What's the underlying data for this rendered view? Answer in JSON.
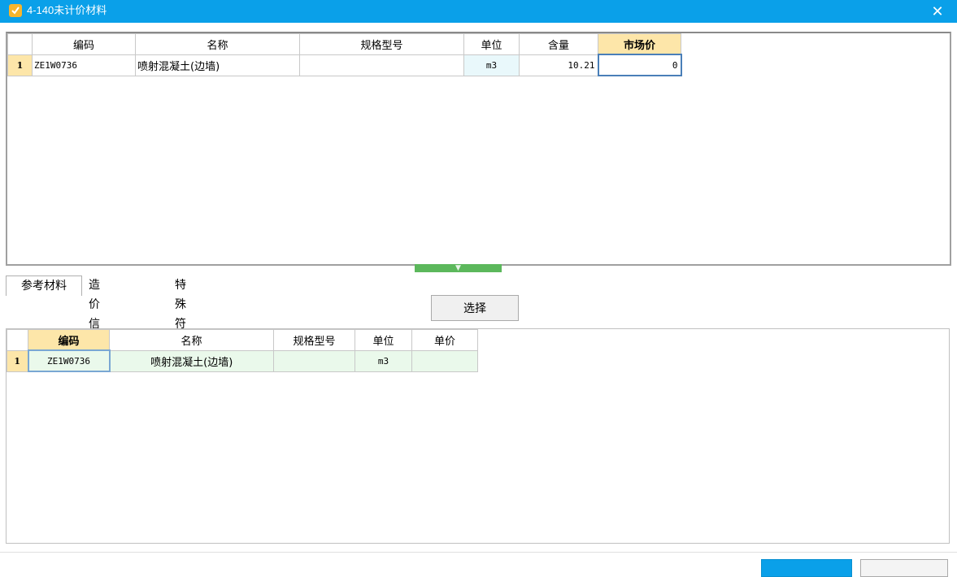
{
  "window": {
    "title": "4-140未计价材料",
    "close_glyph": "✕"
  },
  "top_table": {
    "headers": [
      "编码",
      "名称",
      "规格型号",
      "单位",
      "含量",
      "市场价"
    ],
    "rows": [
      {
        "row_num": "1",
        "code": "ZE1W0736",
        "name": "喷射混凝土(边墙)",
        "spec": "",
        "unit": "m3",
        "content": "10.21",
        "market_price": "0"
      }
    ]
  },
  "splitter": {
    "glyph": "▼"
  },
  "tabs": [
    {
      "label": "参考材料"
    },
    {
      "label": "造价信息库"
    },
    {
      "label": "特殊符号"
    }
  ],
  "select_button": {
    "label": "选择"
  },
  "bottom_table": {
    "headers": [
      "编码",
      "名称",
      "规格型号",
      "单位",
      "单价"
    ],
    "rows": [
      {
        "row_num": "1",
        "code": "ZE1W0736",
        "name": "喷射混凝土(边墙)",
        "spec": "",
        "unit": "m3",
        "price": ""
      }
    ]
  },
  "colors": {
    "titlebar": "#0aa0e9",
    "highlight_header": "#fde6a9",
    "green_row": "#eaf9eb",
    "splitter": "#5cb85c"
  }
}
